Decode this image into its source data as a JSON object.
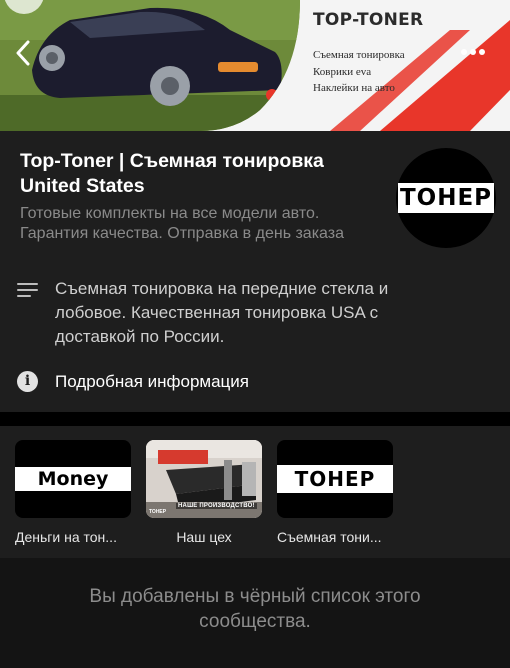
{
  "cover": {
    "brand": "TOP-TONER",
    "lines": [
      "Съемная тонировка",
      "Коврики eva",
      "Наклейки на авто"
    ],
    "accent_color": "#e8362a"
  },
  "nav": {
    "back_icon": "chevron-left-icon",
    "more_icon": "more-horizontal-icon"
  },
  "community": {
    "title": "Top-Toner | Съемная тонировка United States",
    "subtitle": "Готовые комплекты на все модели авто. Гарантия качества. Отправка в день заказа",
    "avatar_text": "ТОНЕР",
    "description": "Съемная тонировка на передние стекла и лобовое. Качественная тонировка USA  с доставкой по России.",
    "description_icon": "text-lines-icon",
    "info_label": "Подробная информация",
    "info_icon": "info-icon"
  },
  "albums": [
    {
      "caption": "Деньги на тон...",
      "thumb_text": "Money"
    },
    {
      "caption": "Наш цех",
      "thumb_text": "НАШЕ ПРОИЗВОДСТВО!",
      "thumb_small": "ТОНЕР"
    },
    {
      "caption": "Съемная тони...",
      "thumb_text": "ТОНЕР"
    }
  ],
  "blocked": {
    "message": "Вы добавлены в чёрный список этого сообщества."
  }
}
